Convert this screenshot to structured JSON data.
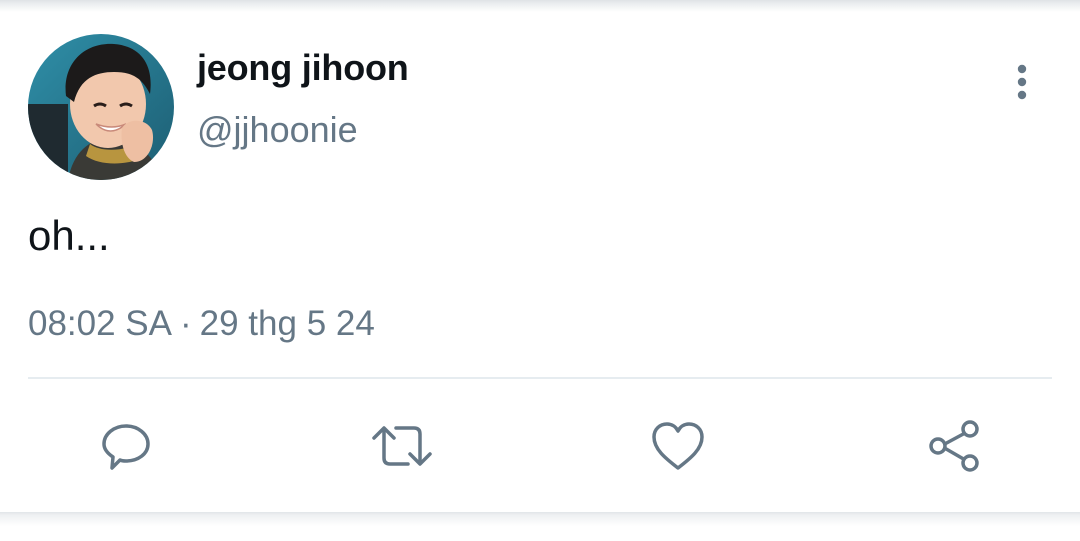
{
  "tweet": {
    "author": {
      "display_name": "jeong jihoon",
      "handle": "@jjhoonie",
      "avatar": "profile-photo"
    },
    "text": "oh...",
    "time": "08:02 SA",
    "separator": "·",
    "date": "29 thg 5 24",
    "more_icon": "more-vertical-icon"
  },
  "actions": [
    {
      "name": "reply",
      "icon": "comment-icon"
    },
    {
      "name": "retweet",
      "icon": "retweet-icon"
    },
    {
      "name": "like",
      "icon": "heart-icon"
    },
    {
      "name": "share",
      "icon": "share-icon"
    }
  ],
  "colors": {
    "primary_text": "#0f1419",
    "secondary_text": "#657786",
    "icon": "#657786",
    "divider": "#e6ecf0"
  }
}
